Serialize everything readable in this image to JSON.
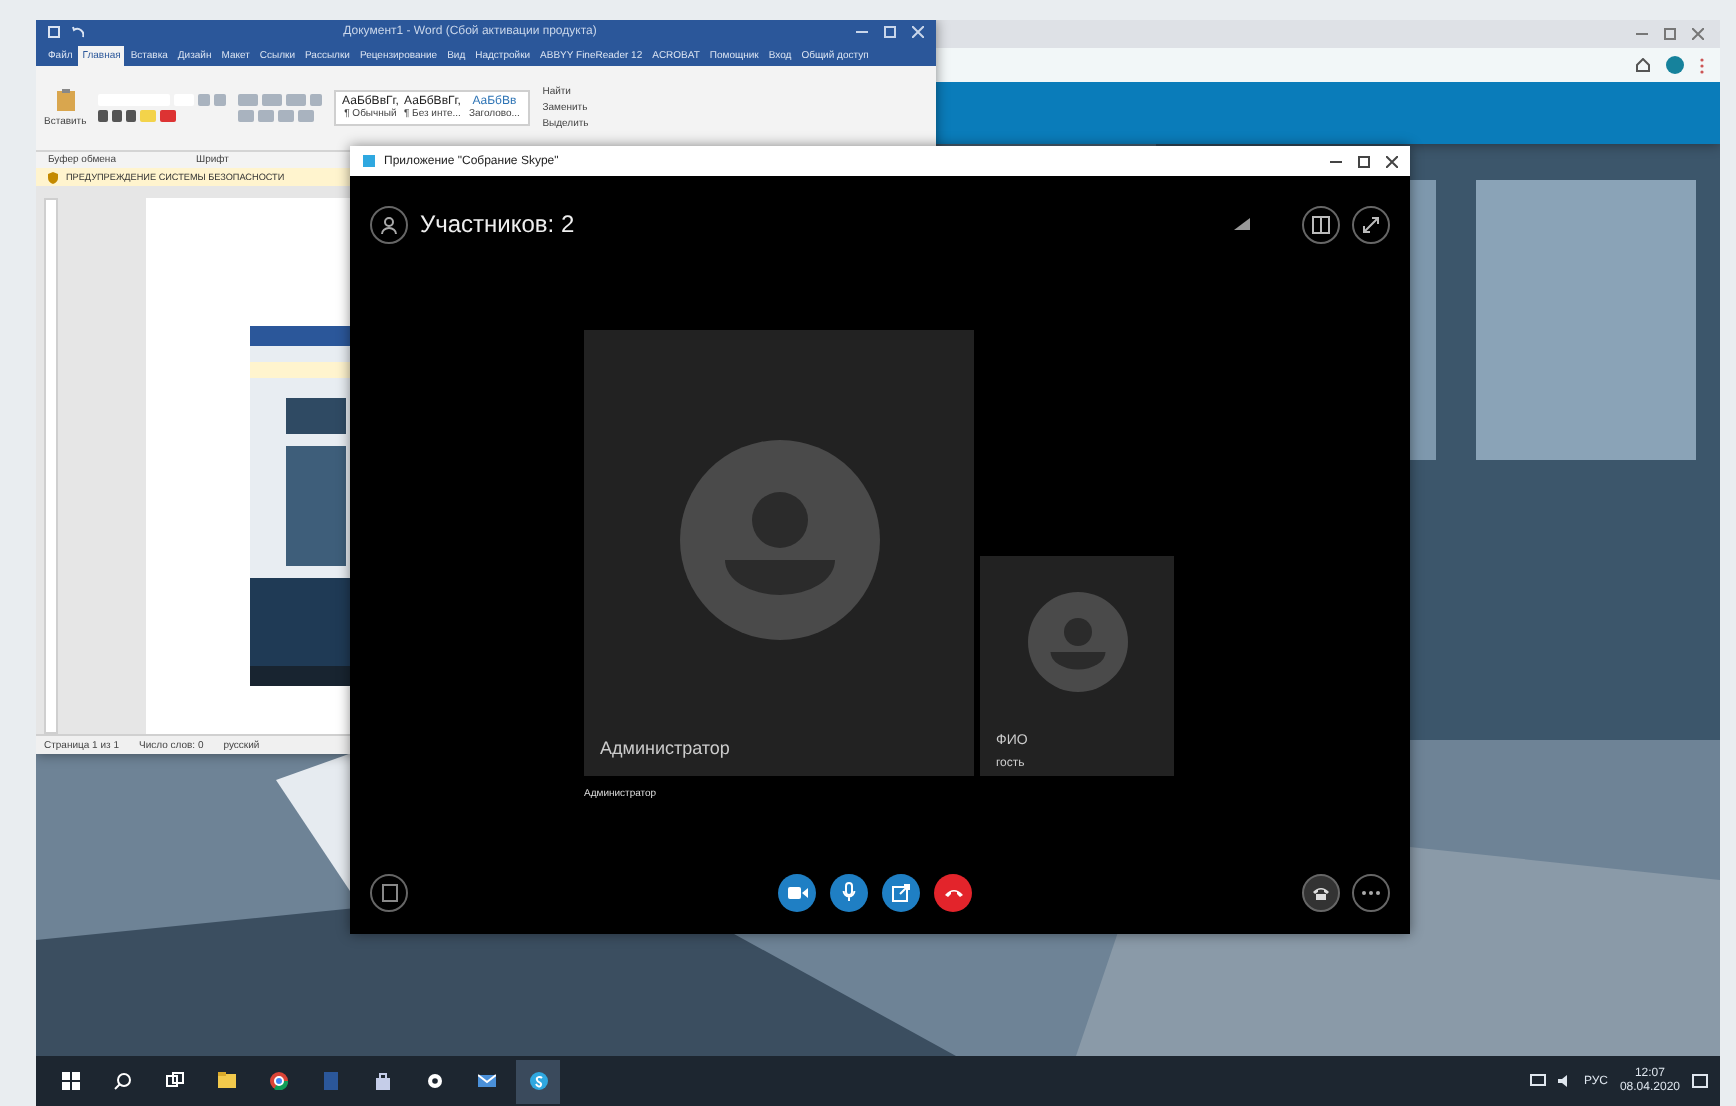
{
  "word_window": {
    "title": "Документ1 - Word (Сбой активации продукта)",
    "tabs": [
      {
        "label": "Файл",
        "selected": false
      },
      {
        "label": "Главная",
        "selected": true
      },
      {
        "label": "Вставка",
        "selected": false
      },
      {
        "label": "Дизайн",
        "selected": false
      },
      {
        "label": "Макет",
        "selected": false
      },
      {
        "label": "Ссылки",
        "selected": false
      },
      {
        "label": "Рассылки",
        "selected": false
      },
      {
        "label": "Рецензирование",
        "selected": false
      },
      {
        "label": "Вид",
        "selected": false
      },
      {
        "label": "Надстройки",
        "selected": false
      },
      {
        "label": "ABBYY FineReader 12",
        "selected": false
      },
      {
        "label": "ACROBAT",
        "selected": false
      }
    ],
    "help": "Помощник",
    "sign_in": "Вход",
    "share": "Общий доступ",
    "paste": "Вставить",
    "styles": [
      {
        "sample": "АаБбВвГг,",
        "name": "¶ Обычный",
        "kind": "text"
      },
      {
        "sample": "АаБбВвГг,",
        "name": "¶ Без инте...",
        "kind": "text"
      },
      {
        "sample": "АаБбВв",
        "name": "Заголово...",
        "kind": "heading"
      }
    ],
    "editing": [
      "Найти",
      "Заменить",
      "Выделить"
    ],
    "groups": [
      "Буфер обмена",
      "Шрифт"
    ],
    "security_bar": "ПРЕДУПРЕЖДЕНИЕ СИСТЕМЫ БЕЗОПАСНОСТИ",
    "status_bar": [
      "Страница 1 из 1",
      "Число слов: 0",
      "русский"
    ]
  },
  "skype_window": {
    "title": "Приложение \"Собрание Skype\"",
    "participants_label": "Участников: 2",
    "participants": [
      {
        "name": "Администратор",
        "kind": "large"
      },
      {
        "name": "ФИО",
        "role": "гость",
        "kind": "small"
      }
    ],
    "caption": "Администратор",
    "controls": [
      {
        "kind": "video",
        "color": "#1f7fc4"
      },
      {
        "kind": "mic",
        "color": "#1f7fc4"
      },
      {
        "kind": "share",
        "color": "#1f7fc4"
      },
      {
        "kind": "hangup",
        "color": "#e3242b"
      }
    ]
  },
  "taskbar": {
    "tray": "РУС",
    "time": "12:07",
    "date": "08.04.2020"
  }
}
